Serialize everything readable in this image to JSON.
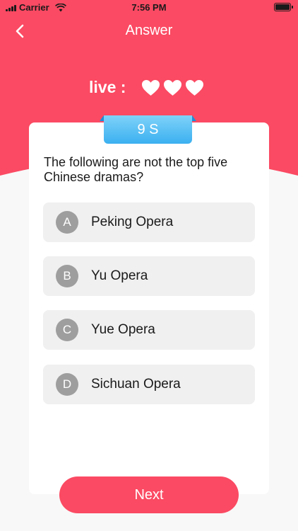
{
  "colors": {
    "accent": "#fb4a63",
    "timer": "#4cbcf4",
    "option_bg": "#f0f0f0",
    "letter_bg": "#9e9e9e"
  },
  "status_bar": {
    "carrier": "Carrier",
    "time": "7:56 PM"
  },
  "nav": {
    "title": "Answer",
    "back_icon": "chevron-left-icon"
  },
  "lives": {
    "label": "live :",
    "count": 3,
    "icon": "heart-icon"
  },
  "timer": {
    "label": "9 S"
  },
  "question": {
    "text": "The following are not the top five Chinese dramas?"
  },
  "options": [
    {
      "letter": "A",
      "text": "Peking Opera"
    },
    {
      "letter": "B",
      "text": "Yu Opera"
    },
    {
      "letter": "C",
      "text": "Yue Opera"
    },
    {
      "letter": "D",
      "text": "Sichuan Opera"
    }
  ],
  "next_button": {
    "label": "Next"
  }
}
